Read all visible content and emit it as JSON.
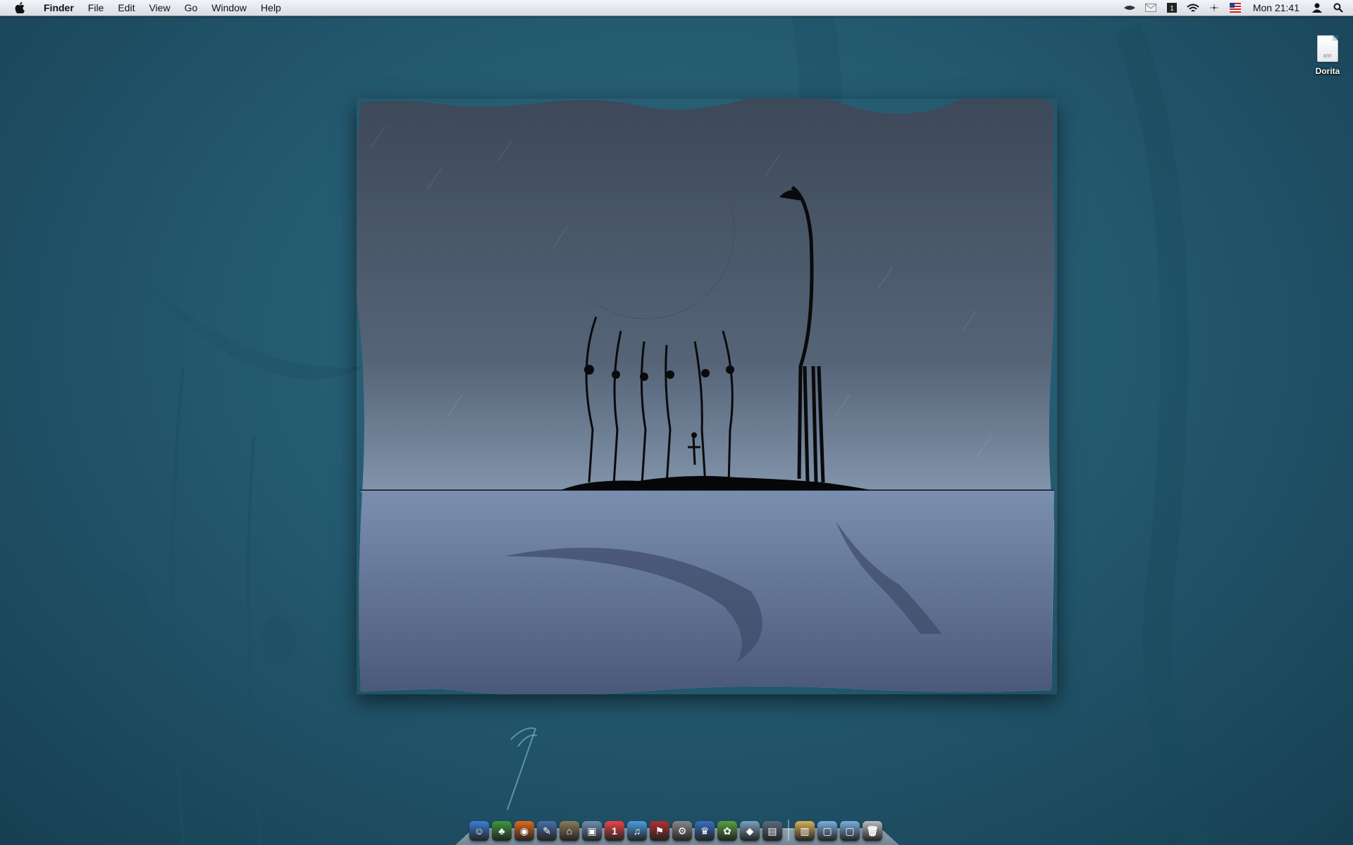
{
  "menubar": {
    "app_name": "Finder",
    "menus": [
      "File",
      "Edit",
      "View",
      "Go",
      "Window",
      "Help"
    ],
    "status_icons": [
      "butler-icon",
      "mail-icon",
      "spaces-icon",
      "wifi-icon",
      "bluetooth-icon",
      "us-flag-input-icon"
    ],
    "clock": "Mon 21:41",
    "user_icon": "user-icon",
    "spotlight_icon": "spotlight-search-icon"
  },
  "desktop": {
    "file_icon": {
      "name": "Dorita",
      "ext": "RTF"
    }
  },
  "dock": {
    "apps": [
      {
        "name": "finder-dock-icon",
        "color": "#3b7fd8",
        "glyph": "☺"
      },
      {
        "name": "adium-dock-icon",
        "color": "#3c9a3c",
        "glyph": "♣"
      },
      {
        "name": "firefox-dock-icon",
        "color": "#e06a1a",
        "glyph": "◉"
      },
      {
        "name": "xcode-dock-icon",
        "color": "#4a6fa8",
        "glyph": "✎"
      },
      {
        "name": "museum-app-dock-icon",
        "color": "#8c7a5a",
        "glyph": "⌂"
      },
      {
        "name": "iphoto-dock-icon",
        "color": "#6f8fb0",
        "glyph": "▣"
      },
      {
        "name": "ical-dock-icon",
        "color": "#e44",
        "glyph": "1"
      },
      {
        "name": "itunes-dock-icon",
        "color": "#4a9fe0",
        "glyph": "♫"
      },
      {
        "name": "script-editor-dock-icon",
        "color": "#b03030",
        "glyph": "⚑"
      },
      {
        "name": "system-preferences-dock-icon",
        "color": "#888",
        "glyph": "⚙"
      },
      {
        "name": "crown-app-dock-icon",
        "color": "#3870c0",
        "glyph": "♛"
      },
      {
        "name": "plant-app-dock-icon",
        "color": "#5aa040",
        "glyph": "✿"
      },
      {
        "name": "cube-app-dock-icon",
        "color": "#7aa0c0",
        "glyph": "◆"
      },
      {
        "name": "preview-dock-icon",
        "color": "#5a6b7a",
        "glyph": "▤"
      }
    ],
    "stacks": [
      {
        "name": "documents-stack-icon",
        "color": "#d8b25a",
        "glyph": "▥"
      },
      {
        "name": "applications-folder-icon",
        "color": "#7ab0e0",
        "glyph": "▢"
      },
      {
        "name": "downloads-folder-icon",
        "color": "#7ab0e0",
        "glyph": "▢"
      },
      {
        "name": "trash-icon",
        "color": "#b9bec4",
        "glyph": "🗑"
      }
    ]
  }
}
